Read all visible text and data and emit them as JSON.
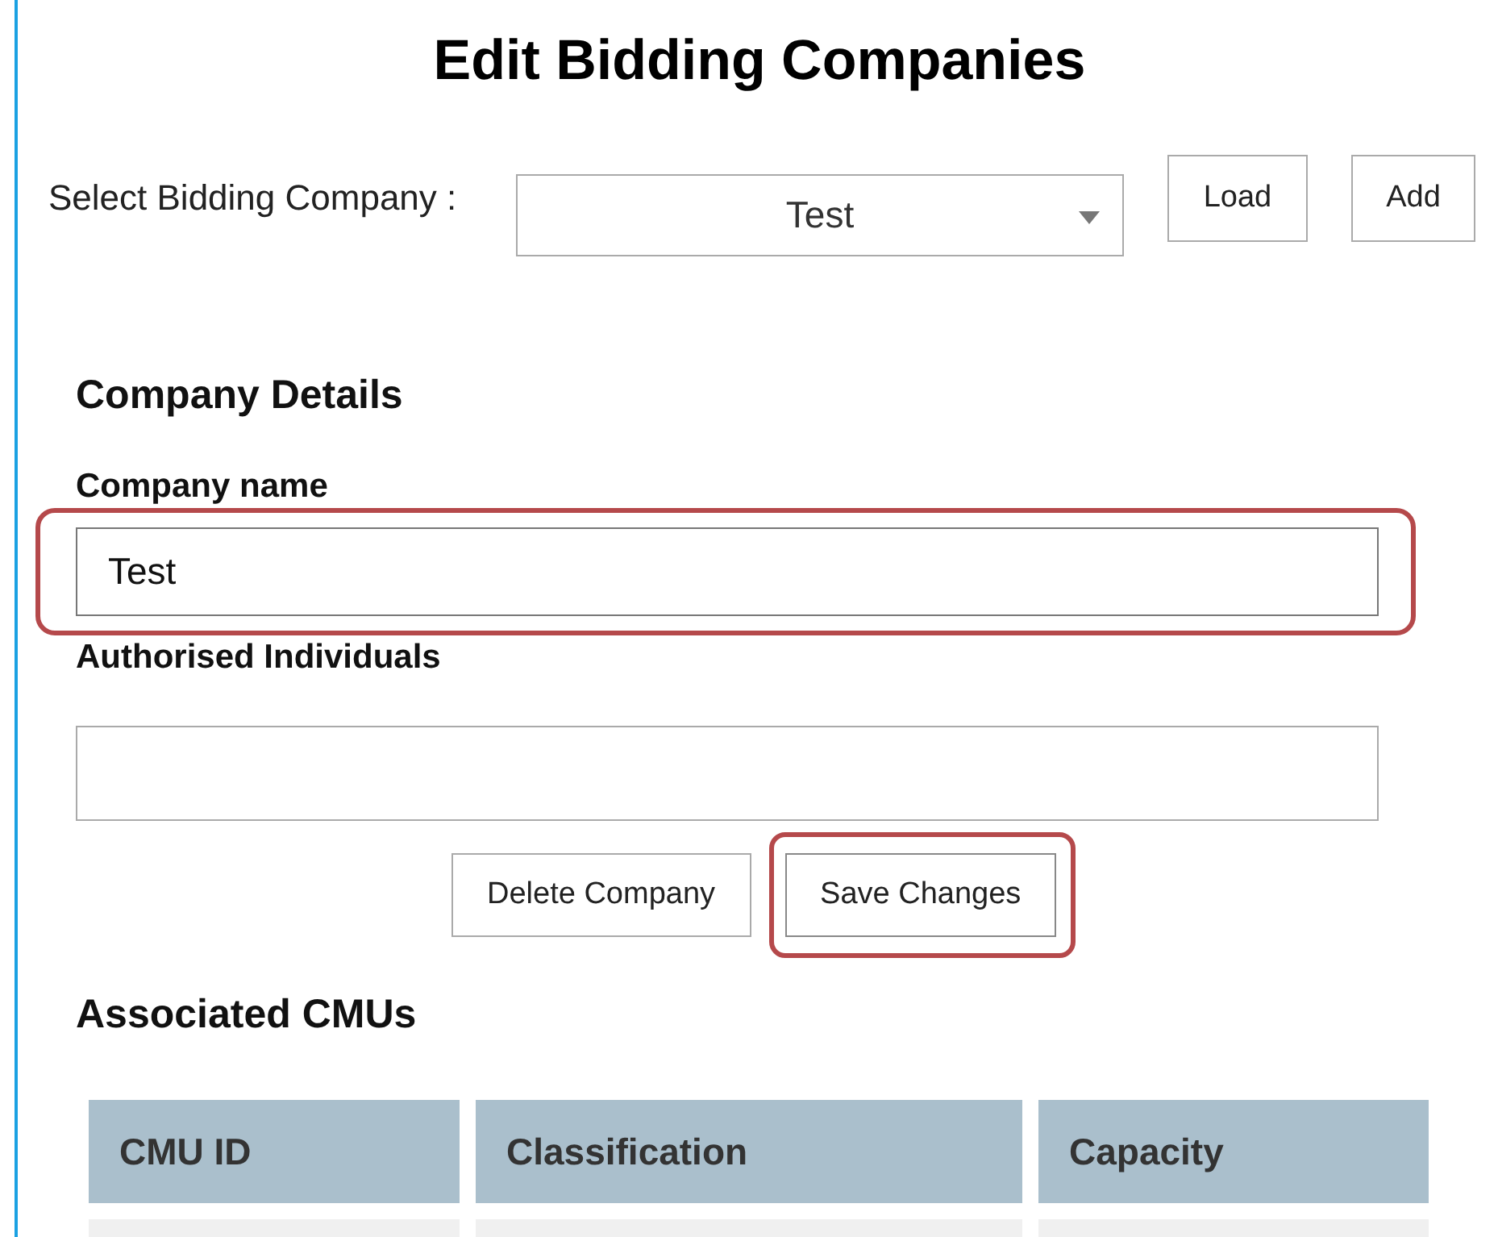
{
  "title": "Edit Bidding Companies",
  "selector": {
    "label": "Select Bidding Company :",
    "value": "Test",
    "buttons": [
      "Load",
      "Add"
    ]
  },
  "details": {
    "heading": "Company Details",
    "fields": [
      {
        "label": "Company name",
        "value": "Test",
        "highlighted": true
      },
      {
        "label": "Authorised Individuals",
        "highlighted": false
      }
    ],
    "buttons": [
      {
        "label": "Delete Company",
        "highlighted": false
      },
      {
        "label": "Save Changes",
        "highlighted": true
      }
    ]
  },
  "cmus": {
    "heading": "Associated CMUs",
    "columns": [
      "CMU ID",
      "Classification",
      "Capacity"
    ]
  }
}
